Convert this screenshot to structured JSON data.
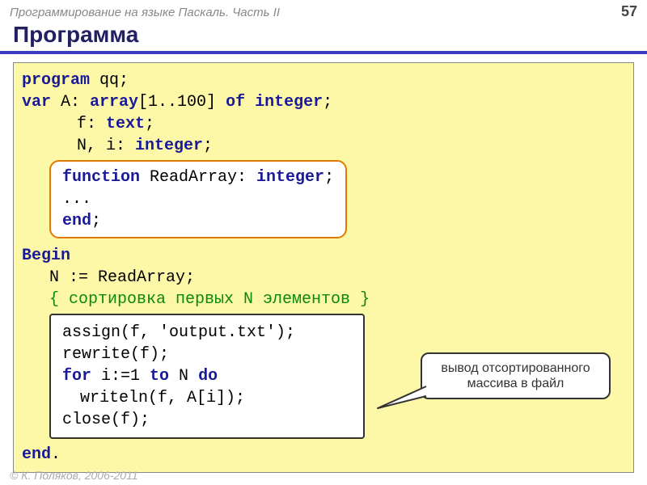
{
  "header": {
    "breadcrumb": "Программирование на языке Паскаль. Часть II",
    "page": "57"
  },
  "title": "Программа",
  "code": {
    "l1a": "program",
    "l1b": " qq;",
    "l2a": "var",
    "l2b": " A: ",
    "l2c": "array",
    "l2d": "[1..100] ",
    "l2e": "of",
    "l2f": " ",
    "l2g": "integer",
    "l2h": ";",
    "l3a": "f: ",
    "l3b": "text",
    "l3c": ";",
    "l4a": "N, i: ",
    "l4b": "integer",
    "l4c": ";",
    "box1_l1a": "function",
    "box1_l1b": " ReadArray: ",
    "box1_l1c": "integer",
    "box1_l1d": ";",
    "box1_l2": "...",
    "box1_l3a": "end",
    "box1_l3b": ";",
    "l5": "Begin",
    "l6": "N := ReadArray;",
    "l7": "{ сортировка первых N элементов }",
    "box2_l1": "assign(f, 'output.txt');",
    "box2_l2": "rewrite(f);",
    "box2_l3a": "for",
    "box2_l3b": " i:=1 ",
    "box2_l3c": "to",
    "box2_l3d": " N ",
    "box2_l3e": "do",
    "box2_l4": "writeln(f, A[i]);",
    "box2_l5": "close(f);",
    "l8a": "end",
    "l8b": "."
  },
  "callout": {
    "line1": "вывод отсортированного",
    "line2": "массива в файл"
  },
  "footer": "© К. Поляков, 2006-2011"
}
